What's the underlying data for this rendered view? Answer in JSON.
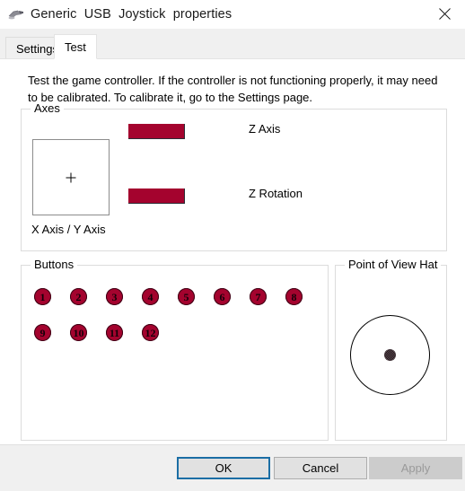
{
  "window": {
    "title": "Generic  USB  Joystick  properties",
    "icon": "joystick-icon",
    "close_label": "✕"
  },
  "tabs": [
    {
      "label": "Settings",
      "active": false
    },
    {
      "label": "Test",
      "active": true
    }
  ],
  "page": {
    "instructions": "Test the game controller.  If the controller is not functioning properly, it may need to be calibrated.  To calibrate it, go to the Settings page."
  },
  "axes": {
    "group_label": "Axes",
    "z_axis": {
      "label": "Z Axis",
      "bar_color": "#a4032e",
      "fill_percent": 50
    },
    "z_rotation": {
      "label": "Z Rotation",
      "bar_color": "#a4032e",
      "fill_percent": 50
    },
    "xy": {
      "label": "X Axis / Y Axis",
      "marker": "+",
      "x_percent": 50,
      "y_percent": 50
    }
  },
  "buttons_panel": {
    "group_label": "Buttons",
    "rows": [
      [
        "1",
        "2",
        "3",
        "4",
        "5",
        "6",
        "7",
        "8"
      ],
      [
        "9",
        "10",
        "11",
        "12"
      ]
    ],
    "button_color": "#a4032e"
  },
  "pov": {
    "group_label": "Point of View Hat",
    "center_dot": "pov-center-dot"
  },
  "footer": {
    "ok": "OK",
    "cancel": "Cancel",
    "apply": "Apply",
    "apply_disabled": true
  }
}
